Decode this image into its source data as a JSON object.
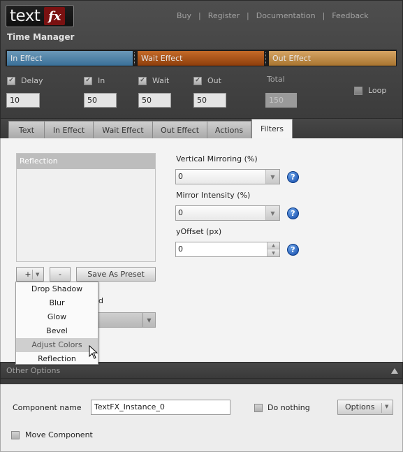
{
  "header": {
    "logo_text": "text",
    "logo_fx": "fx",
    "nav": [
      "Buy",
      "Register",
      "Documentation",
      "Feedback"
    ],
    "nav_separator": "|",
    "title": "Time Manager"
  },
  "timeline": {
    "in_label": "In Effect",
    "wait_label": "Wait Effect",
    "out_label": "Out Effect",
    "in_color": "#3a7098",
    "wait_color": "#8e3e0c",
    "out_color": "#a87530"
  },
  "timing": {
    "delay": {
      "label": "Delay",
      "value": "10",
      "checked": true
    },
    "in": {
      "label": "In",
      "value": "50",
      "checked": true
    },
    "wait": {
      "label": "Wait",
      "value": "50",
      "checked": true
    },
    "out": {
      "label": "Out",
      "value": "50",
      "checked": true
    },
    "total": {
      "label": "Total",
      "value": "150"
    },
    "loop": {
      "label": "Loop",
      "checked": false
    }
  },
  "tabs": [
    "Text",
    "In Effect",
    "Wait Effect",
    "Out Effect",
    "Actions",
    "Filters"
  ],
  "active_tab": "Filters",
  "filters": {
    "list_items": [
      "Reflection"
    ],
    "add_label": "+",
    "remove_label": "-",
    "save_preset_label": "Save As Preset",
    "hidden_label_fragment": "d",
    "add_menu": [
      "Drop Shadow",
      "Blur",
      "Glow",
      "Bevel",
      "Adjust Colors",
      "Reflection"
    ],
    "add_menu_hovered": "Adjust Colors",
    "vertical_mirroring": {
      "label": "Vertical Mirroring (%)",
      "value": "0"
    },
    "mirror_intensity": {
      "label": "Mirror Intensity (%)",
      "value": "0"
    },
    "yoffset": {
      "label": "yOffset (px)",
      "value": "0"
    },
    "help_glyph": "?"
  },
  "other_options": {
    "title": "Other Options",
    "component_name_label": "Component name",
    "component_name_value": "TextFX_Instance_0",
    "do_nothing_label": "Do nothing",
    "options_button_label": "Options",
    "move_component_label": "Move Component"
  },
  "icons": [
    "dropdown-arrow-icon",
    "help-icon",
    "stepper-up-icon",
    "stepper-down-icon",
    "collapse-icon",
    "mouse-cursor-icon",
    "checkmark-icon"
  ]
}
